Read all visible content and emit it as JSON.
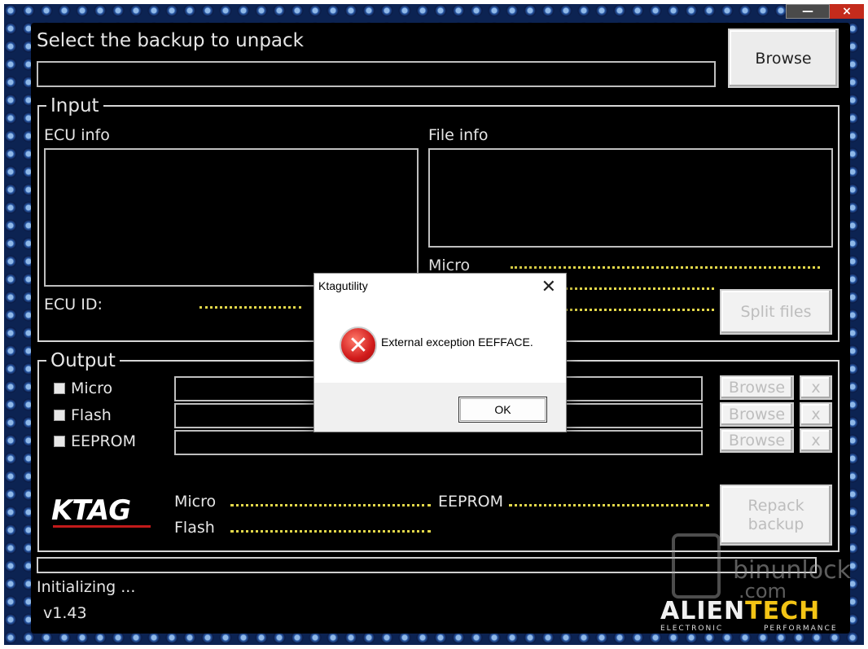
{
  "window": {
    "minimize_label": "—",
    "close_label": "×"
  },
  "header": {
    "title": "Select the backup to unpack",
    "browse_label": "Browse",
    "path_value": ""
  },
  "input_group": {
    "title": "Input",
    "ecu_info_label": "ECU info",
    "file_info_label": "File info",
    "ecu_id_label": "ECU ID:",
    "micro_label": "Micro",
    "split_files_label": "Split files"
  },
  "output_group": {
    "title": "Output",
    "rows": [
      {
        "label": "Micro",
        "browse_label": "Browse",
        "clear_label": "x"
      },
      {
        "label": "Flash",
        "browse_label": "Browse",
        "clear_label": "x"
      },
      {
        "label": "EEPROM",
        "browse_label": "Browse",
        "clear_label": "x"
      }
    ],
    "summary_micro_label": "Micro",
    "summary_flash_label": "Flash",
    "summary_eeprom_label": "EEPROM",
    "repack_line1": "Repack",
    "repack_line2": "backup"
  },
  "logo": {
    "ktag": "KTAG"
  },
  "status": {
    "text": "Initializing ...",
    "version": "v1.43"
  },
  "watermark": {
    "line1": "binunlock",
    "line2": ".com"
  },
  "brand": {
    "name_part1": "ALIEN",
    "name_part2": "TECH",
    "sub_left": "ELECTRONIC",
    "sub_right": "PERFORMANCE"
  },
  "dialog": {
    "title": "Ktagutility",
    "close_label": "✕",
    "message": "External exception EEFFACE.",
    "ok_label": "OK"
  }
}
